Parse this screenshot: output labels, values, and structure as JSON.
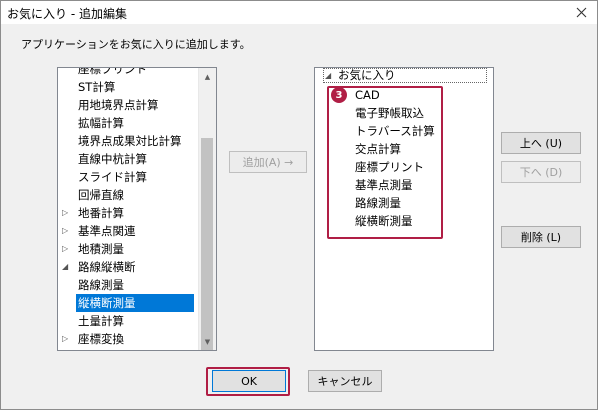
{
  "window": {
    "title": "お気に入り - 追加編集"
  },
  "instruction": "アプリケーションをお気に入りに追加します。",
  "left_tree": [
    {
      "label": "座標プリント"
    },
    {
      "label": "ST計算"
    },
    {
      "label": "用地境界点計算"
    },
    {
      "label": "拡幅計算"
    },
    {
      "label": "境界点成果対比計算"
    },
    {
      "label": "直線中杭計算"
    },
    {
      "label": "スライド計算"
    },
    {
      "label": "回帰直線"
    },
    {
      "label": "地番計算",
      "twisty": "collapsed"
    },
    {
      "label": "基準点関連",
      "twisty": "collapsed"
    },
    {
      "label": "地積測量",
      "twisty": "collapsed"
    },
    {
      "label": "路線縦横断",
      "twisty": "expanded"
    },
    {
      "label": "路線測量"
    },
    {
      "label": "縦横断測量",
      "selected": true
    },
    {
      "label": "土量計算"
    },
    {
      "label": "座標変換",
      "twisty": "collapsed"
    }
  ],
  "right_tree": {
    "root": "お気に入り",
    "items": [
      "CAD",
      "電子野帳取込",
      "トラバース計算",
      "交点計算",
      "座標プリント",
      "基準点測量",
      "路線測量",
      "縦横断測量"
    ]
  },
  "buttons": {
    "add": "追加(A) →",
    "up": "上へ (U)",
    "down": "下へ (D)",
    "delete": "削除 (L)",
    "ok": "OK",
    "cancel": "キャンセル"
  },
  "annotation": {
    "badge": "3"
  },
  "colors": {
    "selection": "#0078d7",
    "annotation": "#b01e45"
  }
}
